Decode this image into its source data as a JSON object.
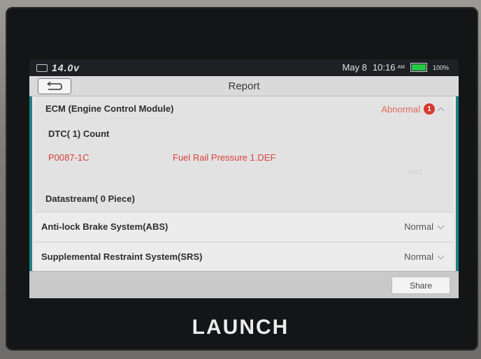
{
  "status_bar": {
    "voltage": "14.0v",
    "date": "May 8",
    "time": "10:16",
    "ampm": "AM",
    "battery_percent": "100%",
    "battery_level": 1.0,
    "battery_color": "#27c847"
  },
  "header": {
    "title": "Report",
    "back_icon": "back-arrow-icon"
  },
  "ecm": {
    "name": "ECM (Engine Control Module)",
    "status": "Abnormal",
    "status_color": "#e06a5c",
    "badge_count": "1",
    "dtc_count_label": "DTC( 1) Count",
    "dtc_codes": [
      {
        "code": "P0087-1C",
        "description": "Fuel Rail Pressure 1.DEF"
      }
    ],
    "faded_button_label": "AST",
    "datastream_label": "Datastream( 0 Piece)"
  },
  "systems": [
    {
      "name": "Anti-lock Brake System(ABS)",
      "status": "Normal"
    },
    {
      "name": "Supplemental Restraint System(SRS)",
      "status": "Normal"
    }
  ],
  "footer": {
    "share_label": "Share"
  },
  "device": {
    "brand": "LAUNCH"
  }
}
